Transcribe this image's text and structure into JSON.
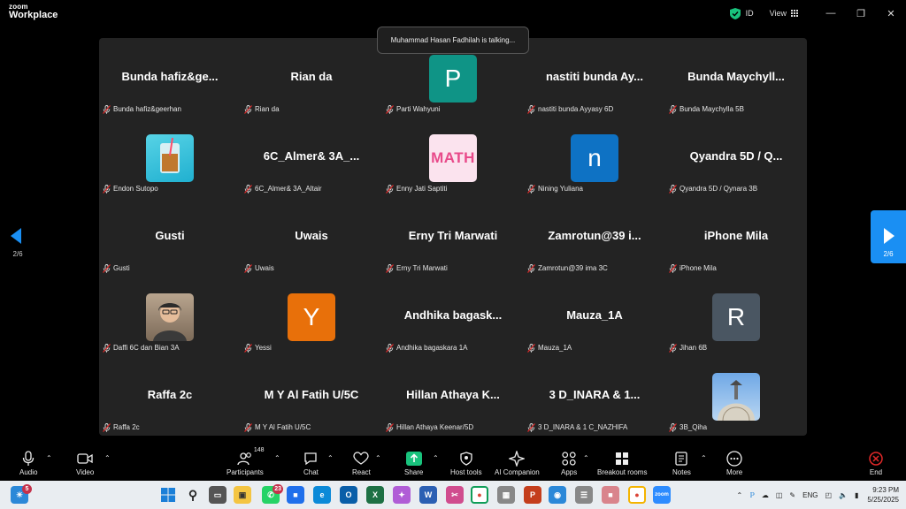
{
  "app": {
    "logo_line1": "zoom",
    "logo_line2": "Workplace",
    "security_label": "ID",
    "view_label": "View"
  },
  "toast": "Muhammad Hasan Fadhilah is talking...",
  "pager": {
    "left": "2/6",
    "right": "2/6"
  },
  "tiles": [
    {
      "name": "Bunda  hafiz&ge...",
      "label": "Bunda hafiz&geerhan"
    },
    {
      "name": "Rian da",
      "label": "Rian da"
    },
    {
      "name": "",
      "label": "Parti Wahyuni",
      "avatar_letter": "P",
      "avatar_color": "#0f9486"
    },
    {
      "name": "nastiti bunda  Ay...",
      "label": "nastiti bunda Ayyasy 6D"
    },
    {
      "name": "Bunda  Maychyll...",
      "label": "Bunda Maychylla 5B"
    },
    {
      "name": "",
      "label": "Endon Sutopo",
      "avatar_image": "drink-photo"
    },
    {
      "name": "6C_Almer&  3A_...",
      "label": "6C_Almer& 3A_Altair"
    },
    {
      "name": "",
      "label": "Enny Jati Saptiti",
      "avatar_image": "math-graphic",
      "avatar_text": "MATH"
    },
    {
      "name": "",
      "label": "Nining Yuliana",
      "avatar_letter": "n",
      "avatar_color": "#0e72c4"
    },
    {
      "name": "Qyandra  5D / Q...",
      "label": "Qyandra 5D / Qynara 3B"
    },
    {
      "name": "Gusti",
      "label": "Gusti"
    },
    {
      "name": "Uwais",
      "label": "Uwais"
    },
    {
      "name": "Erny Tri Marwati",
      "label": "Erny Tri Marwati"
    },
    {
      "name": "Zamrotun@39  i...",
      "label": "Zamrotun@39 ima 3C"
    },
    {
      "name": "iPhone Mila",
      "label": "iPhone Mila"
    },
    {
      "name": "",
      "label": "Daffi 6C dan Bian 3A",
      "avatar_image": "person-photo"
    },
    {
      "name": "",
      "label": "Yessi",
      "avatar_letter": "Y",
      "avatar_color": "#e8700a"
    },
    {
      "name": "Andhika  bagask...",
      "label": "Andhika bagaskara 1A"
    },
    {
      "name": "Mauza_1A",
      "label": "Mauza_1A"
    },
    {
      "name": "",
      "label": "Jihan 6B",
      "avatar_letter": "R",
      "avatar_color": "#4a5662"
    },
    {
      "name": "Raffa 2c",
      "label": "Raffa 2c"
    },
    {
      "name": "M Y Al Fatih U/5C",
      "label": "M Y Al Fatih U/5C"
    },
    {
      "name": "Hillan Athaya  K...",
      "label": "Hillan Athaya Keenar/5D"
    },
    {
      "name": "3 D_INARA & 1...",
      "label": "3 D_INARA & 1 C_NAZHIFA"
    },
    {
      "name": "",
      "label": "3B_Qiha",
      "avatar_image": "dome-photo"
    }
  ],
  "toolbar": {
    "audio": "Audio",
    "video": "Video",
    "participants": "Participants",
    "participants_count": "148",
    "chat": "Chat",
    "react": "React",
    "share": "Share",
    "host_tools": "Host tools",
    "ai_companion": "AI Companion",
    "apps": "Apps",
    "breakout_rooms": "Breakout rooms",
    "notes": "Notes",
    "more": "More",
    "end": "End"
  },
  "taskbar": {
    "weather_badge": "5",
    "whatsapp_badge": "23",
    "lang": "ENG",
    "time": "9:23 PM",
    "date": "5/25/2025"
  },
  "colors": {
    "accent": "#1a8ff3",
    "share_green": "#19c37d",
    "end_red": "#e02828",
    "gallery_bg": "#232323"
  }
}
